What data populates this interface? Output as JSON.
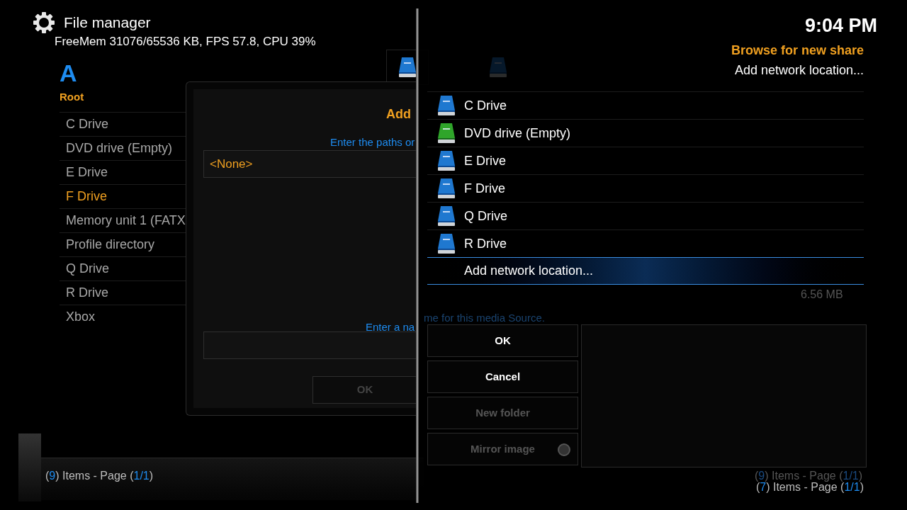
{
  "header": {
    "title": "File manager",
    "system_info": "FreeMem 31076/65536 KB, FPS 57.8, CPU 39%"
  },
  "left_pane": {
    "letter": "A",
    "path": "Root",
    "items": [
      {
        "label": "C Drive",
        "selected": false
      },
      {
        "label": "DVD drive (Empty)",
        "selected": false
      },
      {
        "label": "E Drive",
        "selected": false
      },
      {
        "label": "F Drive",
        "selected": true
      },
      {
        "label": "Memory unit 1 (FATX",
        "selected": false
      },
      {
        "label": "Profile directory",
        "selected": false
      },
      {
        "label": "Q Drive",
        "selected": false
      },
      {
        "label": "R Drive",
        "selected": false
      },
      {
        "label": "Xbox",
        "selected": false
      }
    ],
    "status": [
      {
        "text": "(",
        "kind": "plain"
      },
      {
        "text": "9",
        "kind": "number"
      },
      {
        "text": ") Items - Page (",
        "kind": "plain"
      },
      {
        "text": "1/1",
        "kind": "number"
      },
      {
        "text": ")",
        "kind": "plain"
      }
    ]
  },
  "dialog": {
    "title": "Add",
    "paths_hint": "Enter the paths or",
    "path_value": "<None>",
    "name_hint": "Enter a na",
    "ok": "OK"
  },
  "behind_right": {
    "size_5": "6.56 MB",
    "name_hint_rest": "me for this media Source.",
    "status": [
      {
        "text": "(",
        "kind": "plain"
      },
      {
        "text": "9",
        "kind": "number"
      },
      {
        "text": ") Items - Page (",
        "kind": "plain"
      },
      {
        "text": "1/1",
        "kind": "number"
      },
      {
        "text": ")",
        "kind": "plain"
      }
    ]
  },
  "browser": {
    "clock": "9:04 PM",
    "heading": "Browse for new share",
    "subheading": "Add network location...",
    "items": [
      {
        "label": "C Drive",
        "kind": "drive",
        "selected": false
      },
      {
        "label": "DVD drive (Empty)",
        "kind": "dvd",
        "selected": false
      },
      {
        "label": "E Drive",
        "kind": "drive",
        "selected": false
      },
      {
        "label": "F Drive",
        "kind": "drive",
        "selected": false
      },
      {
        "label": "Q Drive",
        "kind": "drive",
        "selected": false
      },
      {
        "label": "R Drive",
        "kind": "drive",
        "selected": false
      },
      {
        "label": "Add network location...",
        "kind": "none",
        "selected": true
      }
    ],
    "buttons": [
      {
        "label": "OK",
        "kind": "button",
        "disabled": false
      },
      {
        "label": "Cancel",
        "kind": "button",
        "disabled": false
      },
      {
        "label": "New folder",
        "kind": "button",
        "disabled": true
      },
      {
        "label": "Mirror image",
        "kind": "toggle",
        "disabled": true,
        "on": false
      }
    ],
    "status": [
      {
        "text": "(",
        "kind": "plain"
      },
      {
        "text": "7",
        "kind": "number"
      },
      {
        "text": ") Items - Page (",
        "kind": "plain"
      },
      {
        "text": "1/1",
        "kind": "number"
      },
      {
        "text": ")",
        "kind": "plain"
      }
    ]
  }
}
